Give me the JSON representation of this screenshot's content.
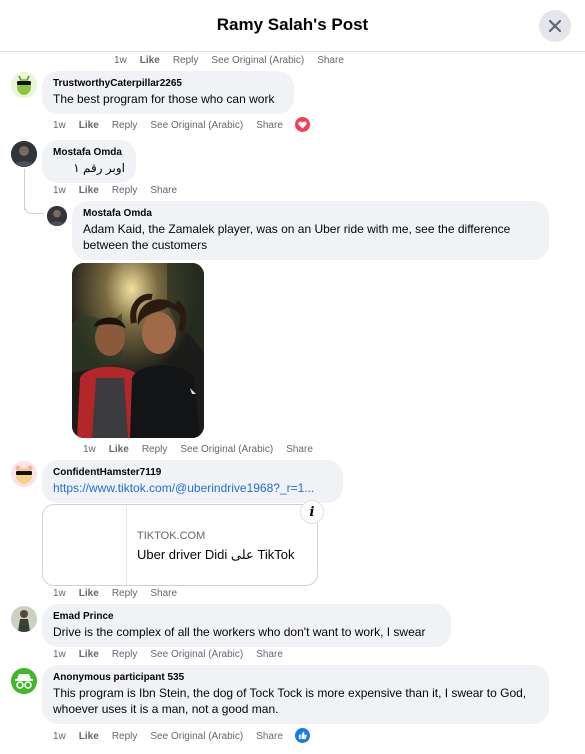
{
  "header": {
    "title": "Ramy Salah's Post"
  },
  "actions_top": {
    "time": "1w",
    "like": "Like",
    "reply": "Reply",
    "see_original": "See Original (Arabic)",
    "share": "Share"
  },
  "comments": [
    {
      "name": "TrustworthyCaterpillar2265",
      "text": "The best program for those who can work",
      "time": "1w",
      "like": "Like",
      "reply": "Reply",
      "see_original": "See Original (Arabic)",
      "share": "Share",
      "reaction": "love-icon"
    },
    {
      "name": "Mostafa Omda",
      "text": "اوبر رقم ١",
      "time": "1w",
      "like": "Like",
      "reply": "Reply",
      "share": "Share"
    },
    {
      "name": "Mostafa Omda",
      "text": "Adam Kaid, the Zamalek player, was on an Uber ride with me, see the difference between the customers",
      "time": "1w",
      "like": "Like",
      "reply": "Reply",
      "see_original": "See Original (Arabic)",
      "share": "Share"
    },
    {
      "name": "ConfidentHamster7119",
      "link": "https://www.tiktok.com/@uberindrive1968?_r=1...",
      "card_domain": "TIKTOK.COM",
      "card_title": "Uber driver Didi على TikTok",
      "time": "1w",
      "like": "Like",
      "reply": "Reply",
      "share": "Share"
    },
    {
      "name": "Emad Prince",
      "text": "Drive is the complex of all the workers who don't want to work, I swear",
      "time": "1w",
      "like": "Like",
      "reply": "Reply",
      "see_original": "See Original (Arabic)",
      "share": "Share"
    },
    {
      "name": "Anonymous participant 535",
      "text": "This program is Ibn Stein, the dog of Tock Tock is more expensive than it, I swear to God, whoever uses it is a man, not a good man.",
      "time": "1w",
      "like": "Like",
      "reply": "Reply",
      "see_original": "See Original (Arabic)",
      "share": "Share",
      "reaction": "like-reaction-icon"
    }
  ],
  "colors": {
    "accent": "#216fdb",
    "bubble": "#f0f2f5",
    "meta": "#65676b",
    "love": "#f33e58",
    "like": "#1877f2"
  }
}
